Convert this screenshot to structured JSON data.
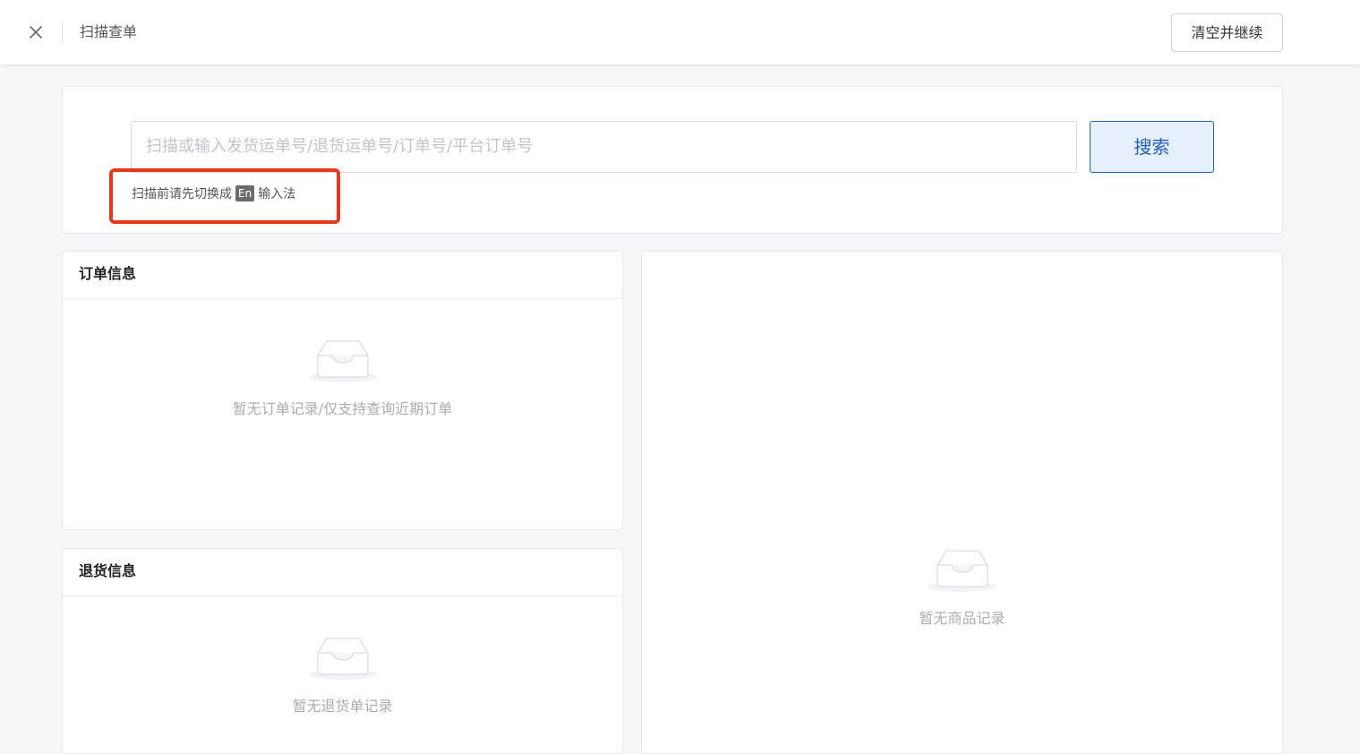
{
  "header": {
    "title": "扫描查单",
    "clear_button": "清空并继续"
  },
  "search": {
    "placeholder": "扫描或输入发货运单号/退货运单号/订单号/平台订单号",
    "button": "搜索",
    "hint_before": "扫描前请先切换成",
    "hint_badge": "En",
    "hint_after": "输入法"
  },
  "order_panel": {
    "title": "订单信息",
    "empty_text": "暂无订单记录/仅支持查询近期订单"
  },
  "return_panel": {
    "title": "退货信息",
    "empty_text": "暂无退货单记录"
  },
  "goods_panel": {
    "empty_text": "暂无商品记录"
  },
  "icons": {
    "close": "close-icon",
    "empty": "empty-inbox-icon"
  },
  "colors": {
    "accent": "#1f5fb8",
    "highlight": "#e5391f"
  }
}
